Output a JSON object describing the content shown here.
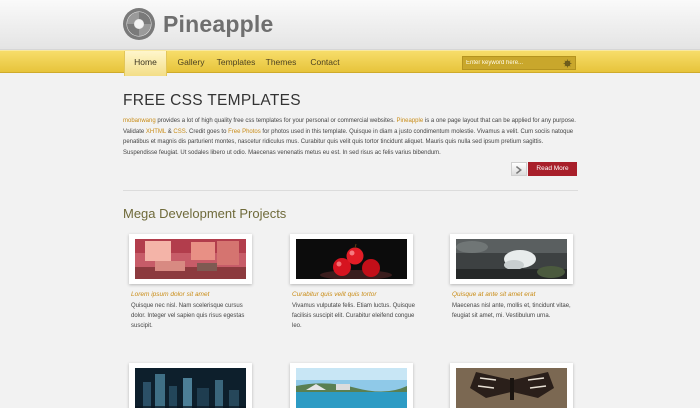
{
  "brand": {
    "name": "Pineapple"
  },
  "nav": {
    "items": [
      "Home",
      "Gallery",
      "Templates",
      "Themes",
      "Contact"
    ],
    "active": "Home"
  },
  "search": {
    "placeholder": "Enter keyword here..."
  },
  "intro": {
    "heading": "FREE CSS TEMPLATES",
    "p1": "mobanwang",
    "p2": " provides a lot of high quality free css templates for your personal or commercial websites. ",
    "p3": "Pineapple",
    "p4": " is a one page layout that can be applied for any purpose. Validate ",
    "p5": "XHTML",
    "p6": " & ",
    "p7": "CSS",
    "p8": ". Credit goes to ",
    "p9": "Free Photos",
    "p10": " for photos used in this template. Quisque in diam a justo condimentum molestie. Vivamus a velit. Cum sociis natoque penatibus et magnis dis parturient montes, nascetur ridiculus mus. Curabitur quis velit quis tortor tincidunt aliquet. Mauris quis nulla sed ipsum pretium sagittis. Suspendisse feugiat. Ut sodales libero ut odio. Maecenas venenatis metus eu est. In sed risus ac felis varius bibendum.",
    "more_label": "Read More"
  },
  "projects": {
    "heading": "Mega Development Projects",
    "cards": [
      {
        "title": "Lorem ipsum dolor sit amet",
        "desc": "Quisque nec nisl. Nam scelerisque cursus dolor. Integer vel sapien quis risus egestas suscipit."
      },
      {
        "title": "Curabitur quis velit quis tortor",
        "desc": "Vivamus vulputate felis. Etiam luctus. Quisque facilisis suscipit elit. Curabitur eleifend congue leo."
      },
      {
        "title": "Quisque at ante sit amet erat",
        "desc": "Maecenas nisl ante, mollis et, tincidunt vitae, feugiat sit amet, mi. Vestibulum urna."
      }
    ]
  },
  "colors": {
    "nav": "#e7c43b",
    "accent": "#c98c16",
    "button": "#a81f2a",
    "heading2": "#6f6a3a"
  },
  "icons": [
    "logo-swirl-icon",
    "search-icon",
    "arrow-right-icon"
  ]
}
